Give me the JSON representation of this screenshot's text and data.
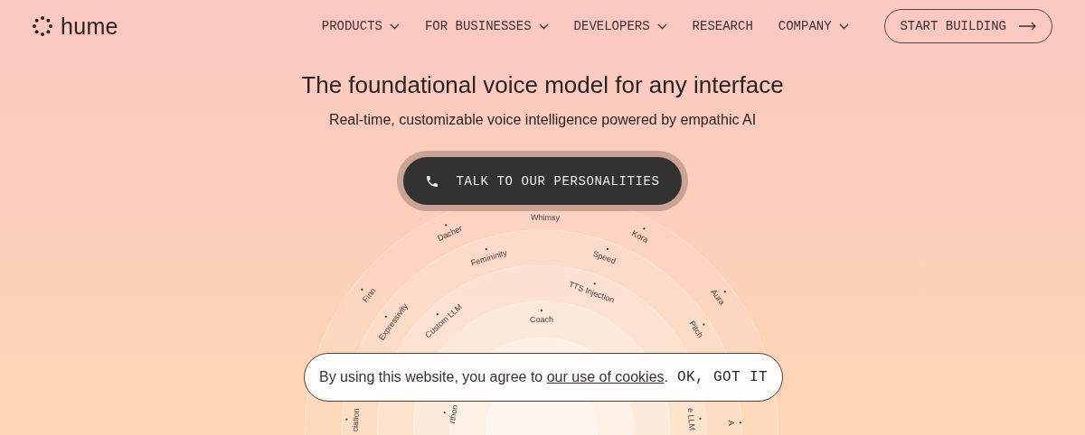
{
  "brand": {
    "name": "hume"
  },
  "nav": [
    {
      "label": "PRODUCTS",
      "has_menu": true
    },
    {
      "label": "FOR BUSINESSES",
      "has_menu": true
    },
    {
      "label": "DEVELOPERS",
      "has_menu": true
    },
    {
      "label": "RESEARCH",
      "has_menu": false
    },
    {
      "label": "COMPANY",
      "has_menu": true
    }
  ],
  "cta": {
    "label": "START BUILDING"
  },
  "hero": {
    "title": "The foundational voice model for any interface",
    "subtitle": "Real-time, customizable voice intelligence powered by empathic AI",
    "button": "TALK TO OUR PERSONALITIES"
  },
  "diagram": {
    "labels": [
      {
        "text": "Whimsy"
      },
      {
        "text": "Dacher"
      },
      {
        "text": "Kora"
      },
      {
        "text": "Finn"
      },
      {
        "text": "Aura"
      },
      {
        "text": "Femininity"
      },
      {
        "text": "Speed"
      },
      {
        "text": "Expressivity"
      },
      {
        "text": "Pitch"
      },
      {
        "text": "Custom LLM"
      },
      {
        "text": "TTS Injection"
      },
      {
        "text": "Coach"
      },
      {
        "text": "ciation"
      },
      {
        "text": "rthon"
      },
      {
        "text": "e LLM"
      },
      {
        "text": "A"
      }
    ]
  },
  "cookie_banner": {
    "text_before": "By using this website, you agree to ",
    "link": "our use of cookies",
    "text_after": ".",
    "button": "OK, GOT IT"
  }
}
